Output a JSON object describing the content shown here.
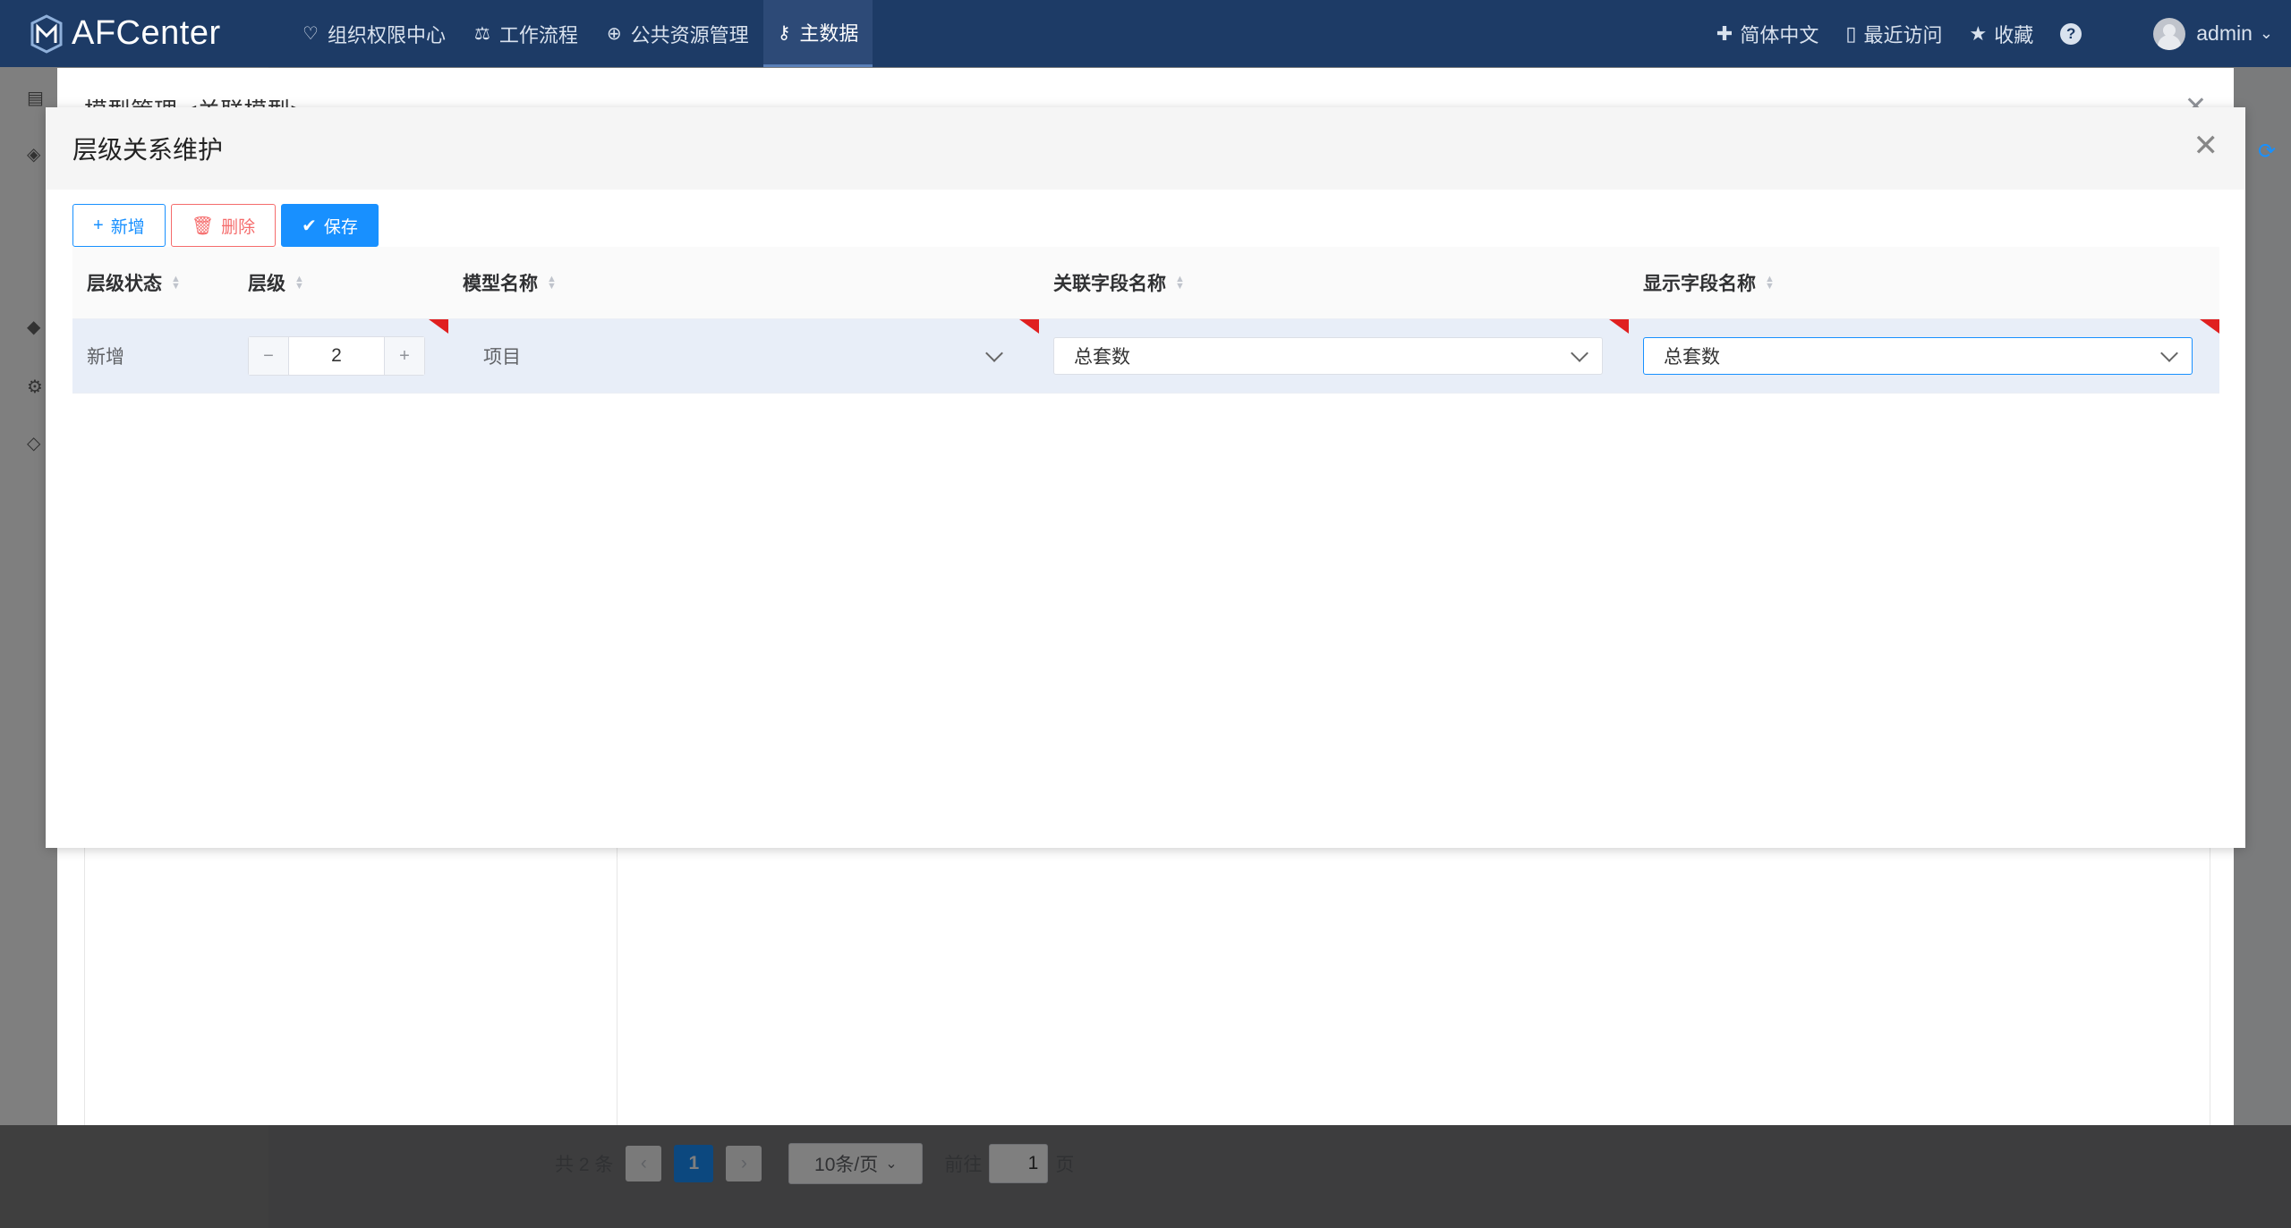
{
  "app": {
    "name": "AFCenter",
    "brand_color": "#1d3b66",
    "accent": "#1890ff"
  },
  "nav": [
    {
      "label": "组织权限中心",
      "icon": "heart-shield-icon"
    },
    {
      "label": "工作流程",
      "icon": "scale-icon"
    },
    {
      "label": "公共资源管理",
      "icon": "binoculars-icon"
    },
    {
      "label": "主数据",
      "icon": "data-key-icon",
      "active": true
    }
  ],
  "header_tools": {
    "language": "简体中文",
    "recent": "最近访问",
    "favorites": "收藏",
    "user": "admin"
  },
  "back_dialog": {
    "title": "模型管理 <关联模型>"
  },
  "pagination": {
    "total": "共 2 条",
    "current_page": "1",
    "page_size": "10条/页",
    "goto_prefix": "前往",
    "goto_value": "1",
    "goto_suffix": "页"
  },
  "dialog": {
    "title": "层级关系维护",
    "buttons": {
      "add": "新增",
      "delete": "删除",
      "save": "保存"
    },
    "columns": [
      "层级状态",
      "层级",
      "模型名称",
      "关联字段名称",
      "显示字段名称"
    ],
    "rows": [
      {
        "status": "新增",
        "level": "2",
        "model_name": "项目",
        "link_field": "总套数",
        "display_field": "总套数"
      }
    ]
  }
}
